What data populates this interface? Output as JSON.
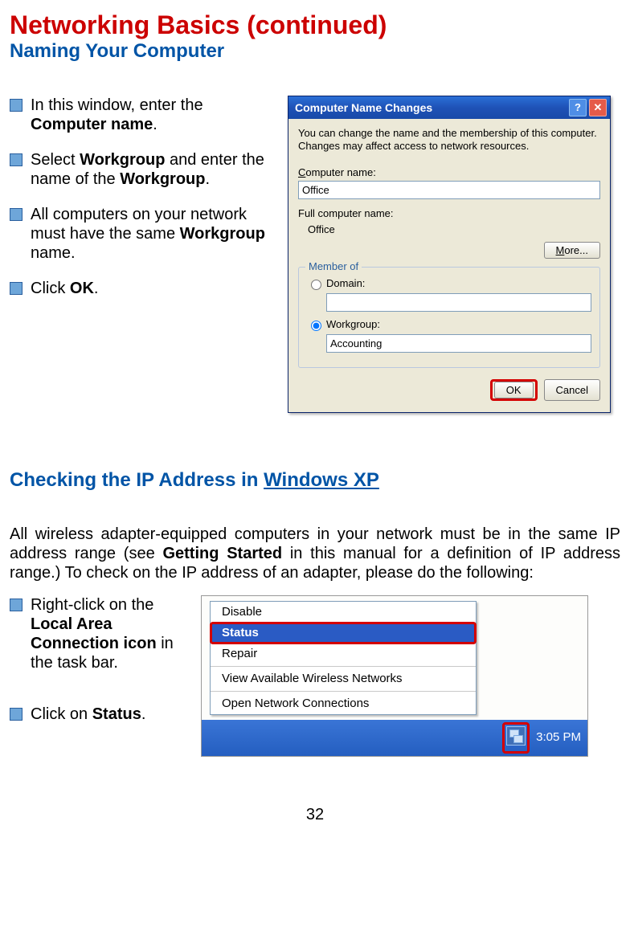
{
  "header": {
    "title": "Networking Basics (continued)",
    "subtitle": "Naming Your Computer"
  },
  "bullets1": [
    {
      "pre": "In this window, enter the ",
      "bold": "Computer name",
      "post": "."
    },
    {
      "pre": "Select ",
      "bold": "Workgroup",
      "mid": " and enter the name of the ",
      "bold2": "Workgroup",
      "post": "."
    },
    {
      "pre": "All computers on your network must have the same ",
      "bold": "Workgroup",
      "post": " name."
    },
    {
      "pre": "Click ",
      "bold": "OK",
      "post": "."
    }
  ],
  "dialog": {
    "title": "Computer Name Changes",
    "desc": "You can change the name and the membership of this computer. Changes may affect access to network resources.",
    "computer_name_label_pre": "C",
    "computer_name_label_rest": "omputer name:",
    "computer_name_value": "Office",
    "full_name_label": "Full computer name:",
    "full_name_value": "Office",
    "more_label": "More...",
    "member_of": "Member of",
    "domain_label_pre": "D",
    "domain_label_rest": "omain:",
    "domain_value": "",
    "workgroup_label_pre": "W",
    "workgroup_label_rest": "orkgroup:",
    "workgroup_value": "Accounting",
    "ok": "OK",
    "cancel": "Cancel"
  },
  "section2": {
    "title_pre": "Checking the IP Address in ",
    "title_os": "Windows XP",
    "para_pre": "All wireless adapter-equipped computers in your network must be in the same IP address range (see ",
    "para_bold": "Getting Started",
    "para_post": " in this manual for a definition of IP address range.) To check on the IP address of an adapter, please do the following:"
  },
  "bullets2": [
    {
      "pre": "Right-click on the ",
      "bold": "Local Area Connection icon",
      "post": " in the task bar."
    },
    {
      "pre": "Click on ",
      "bold": "Status",
      "post": "."
    }
  ],
  "context_menu": {
    "items": [
      "Disable",
      "Status",
      "Repair",
      "View Available Wireless Networks",
      "Open Network Connections"
    ],
    "selected_index": 1,
    "taskbar_time": "3:05 PM"
  },
  "page_number": "32"
}
